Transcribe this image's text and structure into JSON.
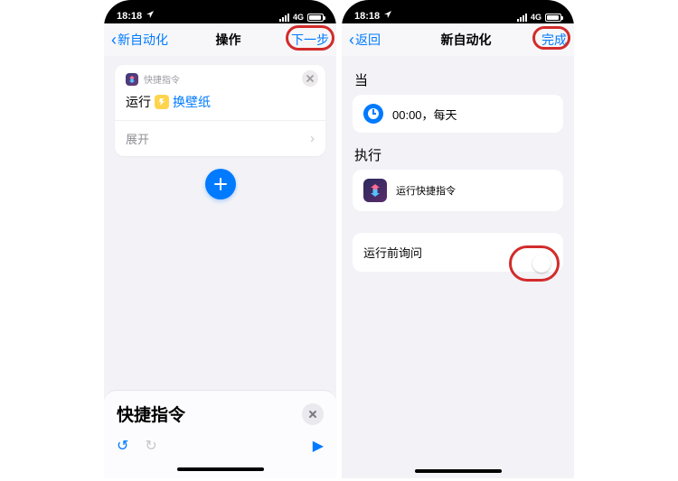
{
  "status": {
    "time": "18:18",
    "network": "4G"
  },
  "left": {
    "nav": {
      "back": "新自动化",
      "title": "操作",
      "action": "下一步"
    },
    "card": {
      "header": "快捷指令",
      "run_label": "运行",
      "shortcut_name": "换壁纸",
      "expand": "展开"
    },
    "drawer": {
      "title": "快捷指令"
    }
  },
  "right": {
    "nav": {
      "back": "返回",
      "title": "新自动化",
      "action": "完成"
    },
    "when_title": "当",
    "schedule": "00:00，每天",
    "do_title": "执行",
    "run_label": "运行快捷指令",
    "ask_label": "运行前询问"
  }
}
